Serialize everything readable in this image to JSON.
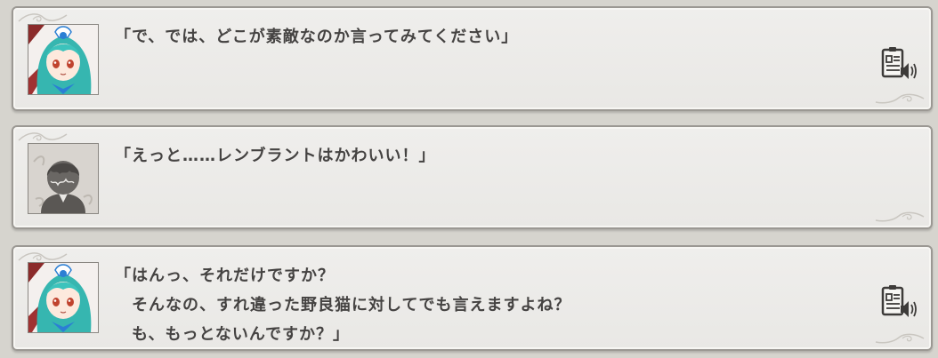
{
  "backlog": {
    "entries": [
      {
        "portrait": "teal-haired-girl-portrait",
        "text": "「で、では、どこが素敵なのか言ってみてください」",
        "has_voice": true
      },
      {
        "portrait": "silhouette-player-portrait",
        "text": "「えっと……レンブラントはかわいい！」",
        "has_voice": false
      },
      {
        "portrait": "teal-haired-girl-portrait",
        "text": "「はんっ、それだけですか？\n　そんなの、すれ違った野良猫に対してでも言えますよね？\n　も、もっとないんですか？」",
        "has_voice": true
      }
    ],
    "voice_icon": "voice-replay-icon"
  }
}
